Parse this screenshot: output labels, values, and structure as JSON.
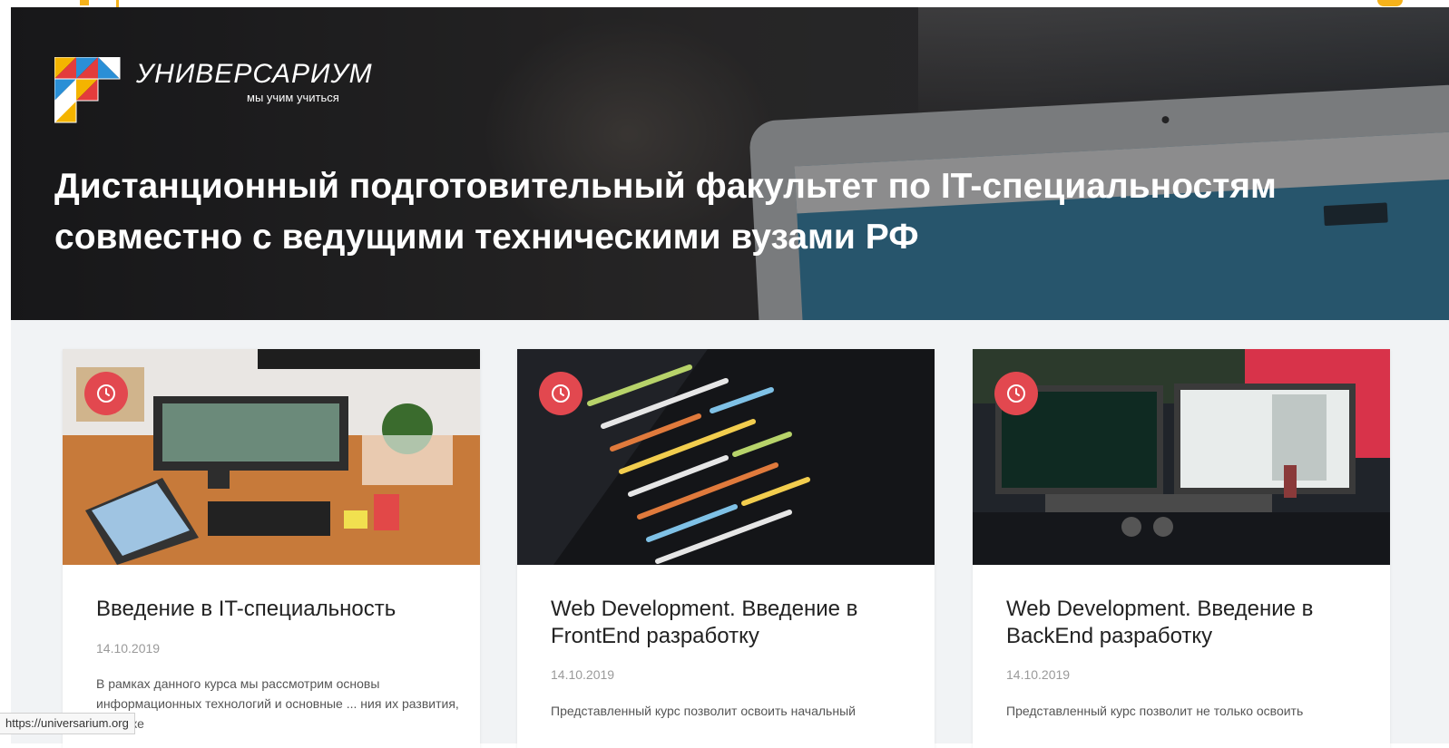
{
  "brand": {
    "name": "УНИВЕРСАРИУМ",
    "tagline": "мы учим учиться"
  },
  "hero": {
    "title": "Дистанционный подготовительный факультет по IT-специальностям совместно с ведущими техническими вузами РФ"
  },
  "cards": [
    {
      "title": "Введение в IT-специальность",
      "date": "14.10.2019",
      "description": "В рамках данного курса мы рассмотрим основы информационных технологий и основные ... ния их развития, а так же"
    },
    {
      "title": "Web Development. Введение в FrontEnd разработку",
      "date": "14.10.2019",
      "description": "Представленный курс позволит освоить начальный"
    },
    {
      "title": "Web Development. Введение в BackEnd разработку",
      "date": "14.10.2019",
      "description": "Представленный курс позволит не только освоить"
    }
  ],
  "status": {
    "url": "https://universarium.org"
  },
  "colors": {
    "accent_red": "#e2484f",
    "accent_yellow": "#f5b21b",
    "content_background": "#f1f3f5"
  },
  "icons": {
    "badge": "clock-icon"
  }
}
